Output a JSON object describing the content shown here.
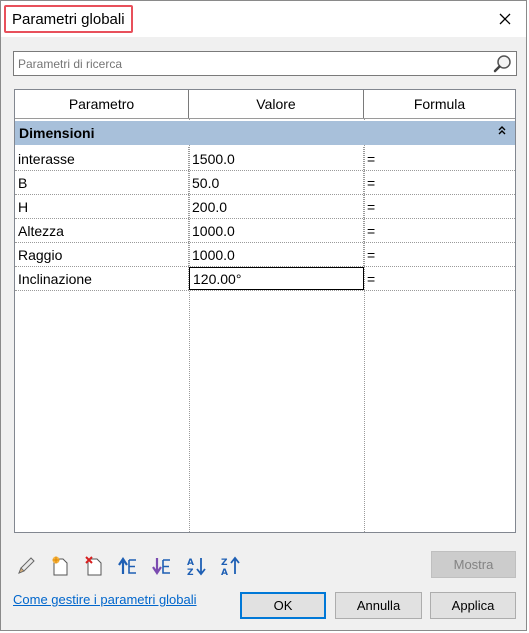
{
  "window": {
    "title": "Parametri globali"
  },
  "search": {
    "placeholder": "Parametri di ricerca"
  },
  "grid": {
    "columns": [
      "Parametro",
      "Valore",
      "Formula"
    ],
    "group": "Dimensioni",
    "rows": [
      {
        "name": "interasse",
        "value": "1500.0",
        "formula": "="
      },
      {
        "name": "B",
        "value": "50.0",
        "formula": "="
      },
      {
        "name": "H",
        "value": "200.0",
        "formula": "="
      },
      {
        "name": "Altezza",
        "value": "1000.0",
        "formula": "="
      },
      {
        "name": "Raggio",
        "value": "1000.0",
        "formula": "="
      },
      {
        "name": "Inclinazione",
        "value": "120.00°",
        "formula": "="
      }
    ]
  },
  "buttons": {
    "mostra": "Mostra",
    "ok": "OK",
    "annulla": "Annulla",
    "applica": "Applica"
  },
  "help_link": "Come gestire i parametri globali",
  "colors": {
    "group_header": "#a8c0da",
    "title_highlight": "#e8505b",
    "link": "#0066cc"
  }
}
